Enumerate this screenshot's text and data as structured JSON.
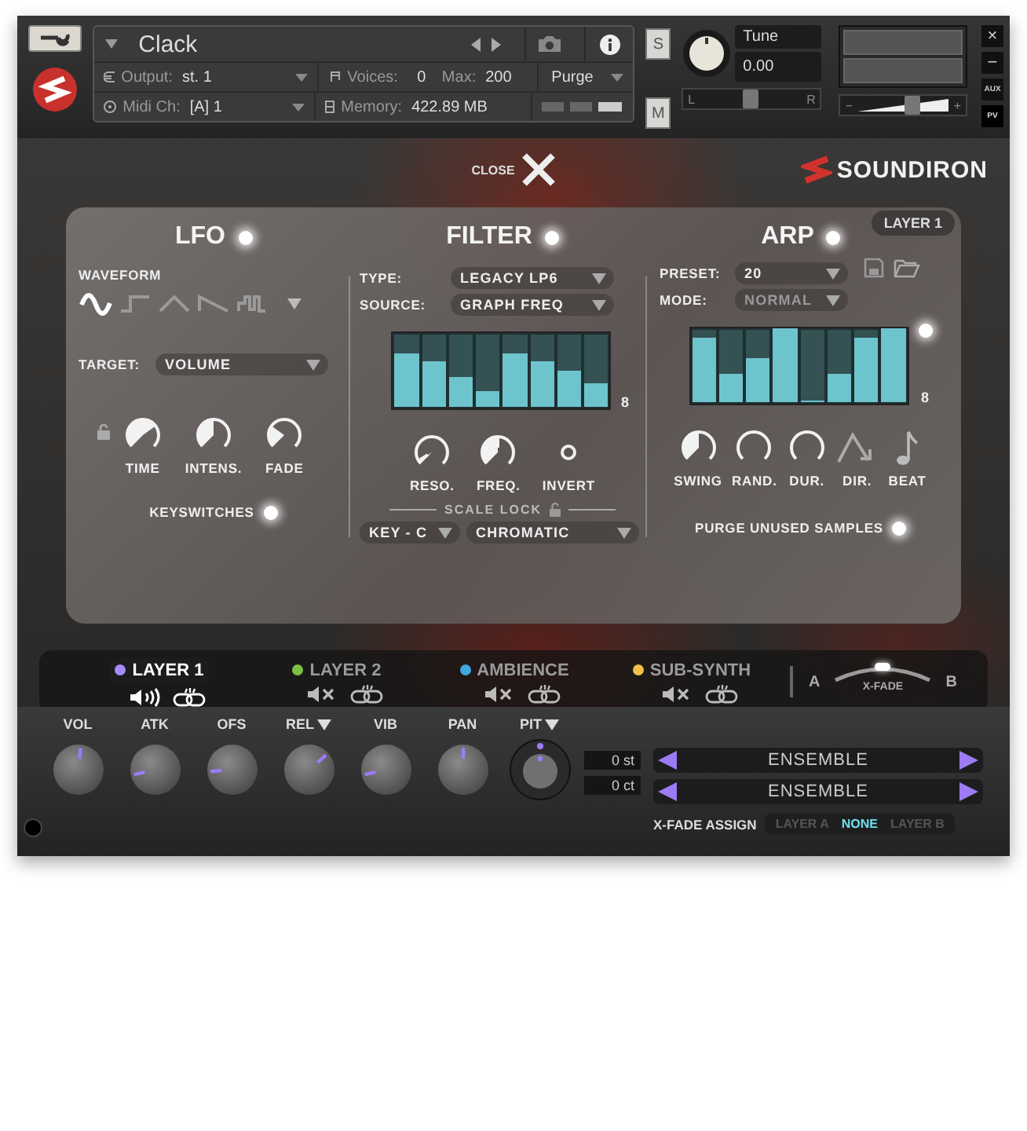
{
  "header": {
    "title": "Clack",
    "output_label": "Output:",
    "output": "st. 1",
    "voices_label": "Voices:",
    "voices": "0",
    "max_label": "Max:",
    "max": "200",
    "purge": "Purge",
    "midi_label": "Midi Ch:",
    "midi": "[A] 1",
    "memory_label": "Memory:",
    "memory": "422.89 MB",
    "solo": "S",
    "mute": "M",
    "tune_label": "Tune",
    "tune": "0.00",
    "pan": {
      "left": "L",
      "right": "R",
      "level": 0.5
    },
    "volume": {
      "minus": "−",
      "plus": "+",
      "level": 0.6
    },
    "close": "×",
    "minimize": "−",
    "aux": "AUX",
    "pv": "PV"
  },
  "close_label": "CLOSE",
  "brand": "SOUNDIRON",
  "layer_badge": "LAYER 1",
  "lfo": {
    "title": "LFO",
    "on": true,
    "waveform_label": "WAVEFORM",
    "waveforms": [
      {
        "kind": "sine",
        "selected": true
      },
      {
        "kind": "square",
        "selected": false
      },
      {
        "kind": "triangle",
        "selected": false
      },
      {
        "kind": "saw",
        "selected": false
      },
      {
        "kind": "random",
        "selected": false
      }
    ],
    "target_label": "TARGET:",
    "target": "VOLUME",
    "knobs": [
      {
        "label": "TIME"
      },
      {
        "label": "INTENS."
      },
      {
        "label": "FADE"
      }
    ],
    "keyswitches": {
      "label": "KEYSWITCHES",
      "on": true
    }
  },
  "filter": {
    "title": "FILTER",
    "on": true,
    "type_label": "TYPE:",
    "type": "LEGACY LP6",
    "source_label": "SOURCE:",
    "source": "GRAPH FREQ",
    "steps": [
      {
        "level": 0.72
      },
      {
        "level": 0.6
      },
      {
        "level": 0.4
      },
      {
        "level": 0.2
      },
      {
        "level": 0.72
      },
      {
        "level": 0.6
      },
      {
        "level": 0.47
      },
      {
        "level": 0.3
      }
    ],
    "step_count": "8",
    "knobs": [
      {
        "label": "RESO."
      },
      {
        "label": "FREQ."
      }
    ],
    "invert": {
      "label": "INVERT",
      "on": false
    },
    "scale_lock_label": "SCALE LOCK",
    "key": "KEY - C",
    "scale": "CHROMATIC"
  },
  "arp": {
    "title": "ARP",
    "on": true,
    "preset_label": "PRESET:",
    "preset": "20",
    "mode_label": "MODE:",
    "mode": "NORMAL",
    "steps": [
      {
        "level": 0.88
      },
      {
        "level": 0.38
      },
      {
        "level": 0.58
      },
      {
        "level": 1
      },
      {
        "level": 0
      },
      {
        "level": 0.38
      },
      {
        "level": 0.88
      },
      {
        "level": 1
      }
    ],
    "step_count": "8",
    "grid_on": true,
    "knobs": [
      {
        "label": "SWING"
      },
      {
        "label": "RAND."
      },
      {
        "label": "DUR."
      }
    ],
    "dir_label": "DIR.",
    "beat_label": "BEAT",
    "purge": {
      "label": "PURGE UNUSED SAMPLES",
      "on": true
    }
  },
  "layers": [
    {
      "name": "LAYER 1",
      "color": "#a78bfa",
      "selected": true,
      "muted": false
    },
    {
      "name": "LAYER 2",
      "color": "#7ac143",
      "selected": false,
      "muted": true
    },
    {
      "name": "AMBIENCE",
      "color": "#3ea8e0",
      "selected": false,
      "muted": true
    },
    {
      "name": "SUB-SYNTH",
      "color": "#f0c04a",
      "selected": false,
      "muted": true
    }
  ],
  "xfade": {
    "a": "A",
    "b": "B",
    "label": "X-FADE",
    "level": 0.5
  },
  "controls": [
    {
      "label": "VOL",
      "kind": "plain"
    },
    {
      "label": "ATK",
      "kind": "plain"
    },
    {
      "label": "OFS",
      "kind": "plain"
    },
    {
      "label": "REL",
      "kind": "menu"
    },
    {
      "label": "VIB",
      "kind": "plain"
    },
    {
      "label": "PAN",
      "kind": "plain"
    }
  ],
  "pitch": {
    "label": "PIT",
    "semitones": "0 st",
    "cents": "0 ct"
  },
  "selectors": [
    "ENSEMBLE",
    "ENSEMBLE"
  ],
  "xfade_assign": {
    "label": "X-FADE ASSIGN",
    "options": [
      {
        "label": "LAYER A",
        "selected": false
      },
      {
        "label": "NONE",
        "selected": true
      },
      {
        "label": "LAYER B",
        "selected": false
      }
    ]
  }
}
